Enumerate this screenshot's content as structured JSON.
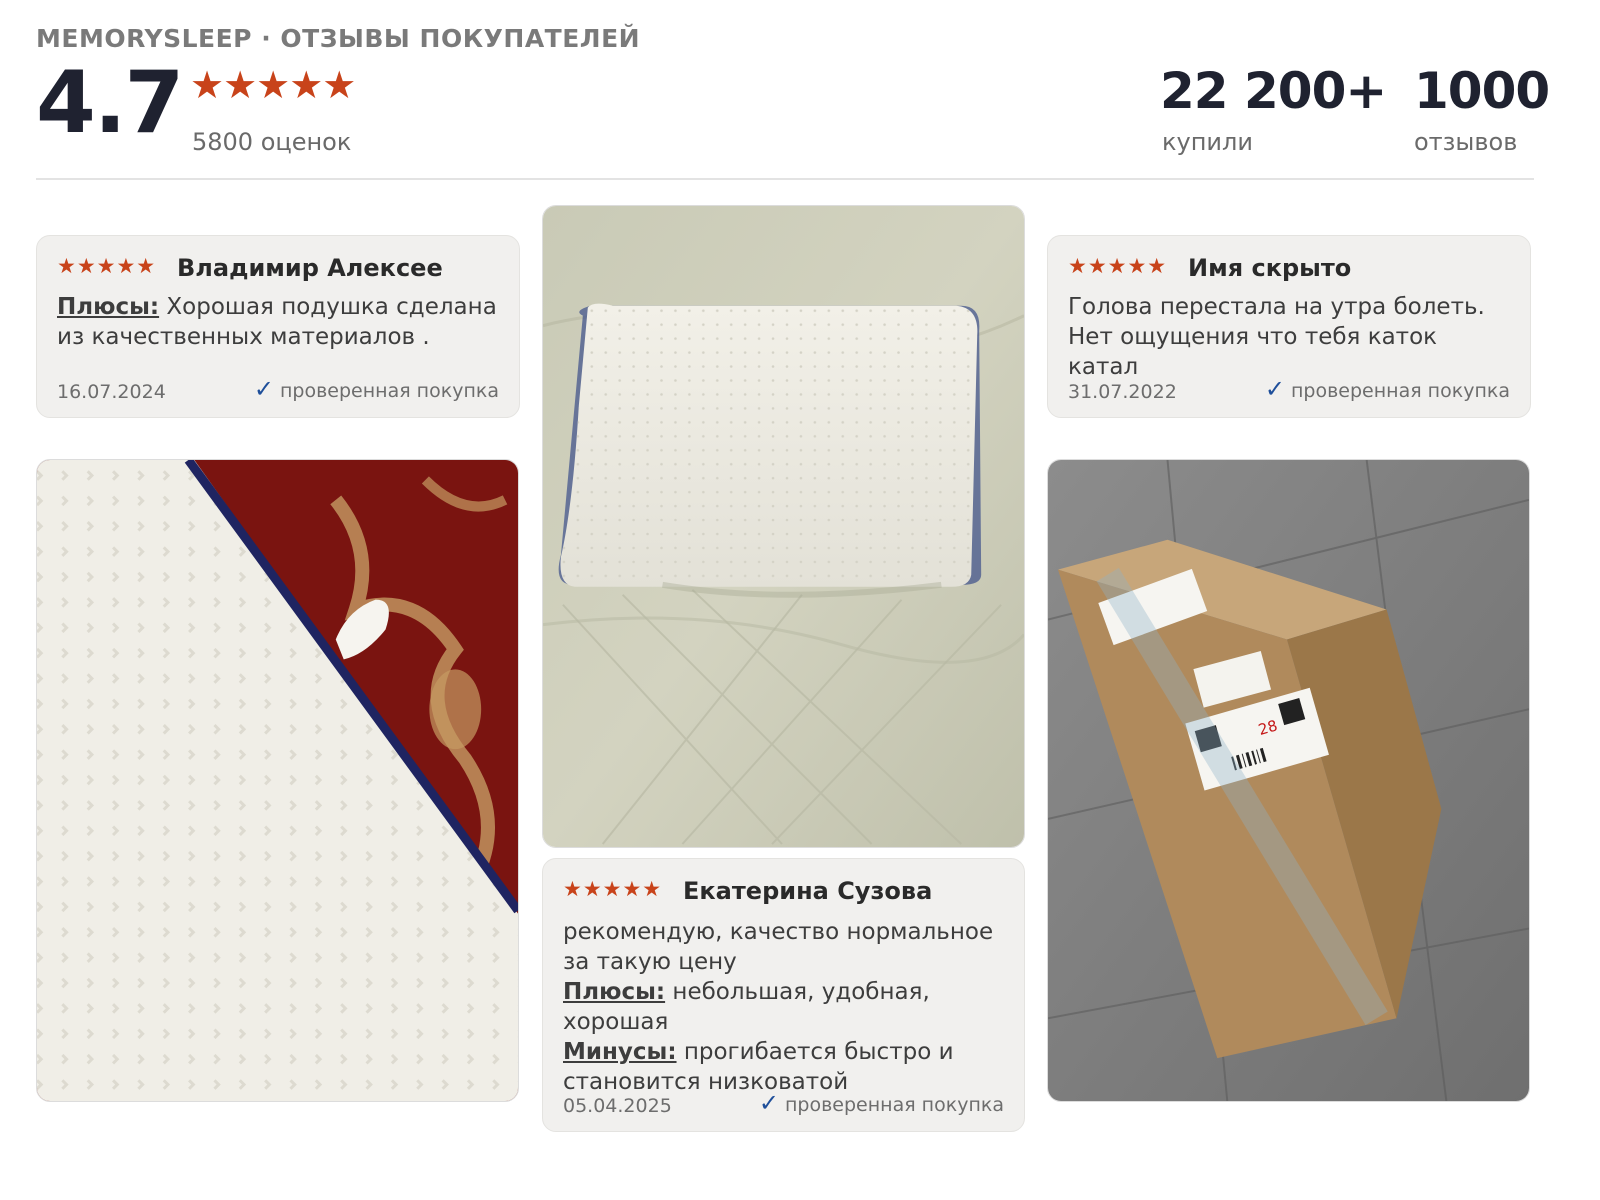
{
  "header": {
    "brand_line": "MEMORYSLEEP · ОТЗЫВЫ ПОКУПАТЕЛЕЙ",
    "rating_value": "4.7",
    "rating_stars": "★★★★★",
    "rating_count": "5800 оценок",
    "stats": [
      {
        "value": "22 200+",
        "label": "купили"
      },
      {
        "value": "1000",
        "label": "отзывов"
      }
    ]
  },
  "reviews": [
    {
      "stars": "★★★★★",
      "author": "Владимир Алексее",
      "pros_label": "Плюсы:",
      "pros_text": " Хорошая подушка сделана из качественных материалов .",
      "date": "16.07.2024",
      "verified": "проверенная покупка"
    },
    {
      "stars": "★★★★★",
      "author": "Екатерина Сузова",
      "text": "рекомендую, качество нормальное за такую цену",
      "pros_label": "Плюсы:",
      "pros_text": " небольшая, удобная, хорошая",
      "cons_label": "Минусы:",
      "cons_text": " прогибается быстро и становится низковатой",
      "date": "05.04.2025",
      "verified": "проверенная покупка"
    },
    {
      "stars": "★★★★★",
      "author": "Имя скрыто",
      "text": "Голова перестала на утра болеть. Нет ощущения что тебя каток катал",
      "date": "31.07.2022",
      "verified": "проверенная покупка"
    }
  ],
  "photos": {
    "box_label_number": "28"
  },
  "colors": {
    "star": "#c8431a",
    "check": "#1f4f9a",
    "card_bg": "#f1f0ee",
    "heading": "#1f2230"
  },
  "icons": {
    "star": "star-icon",
    "verified": "check-icon"
  }
}
